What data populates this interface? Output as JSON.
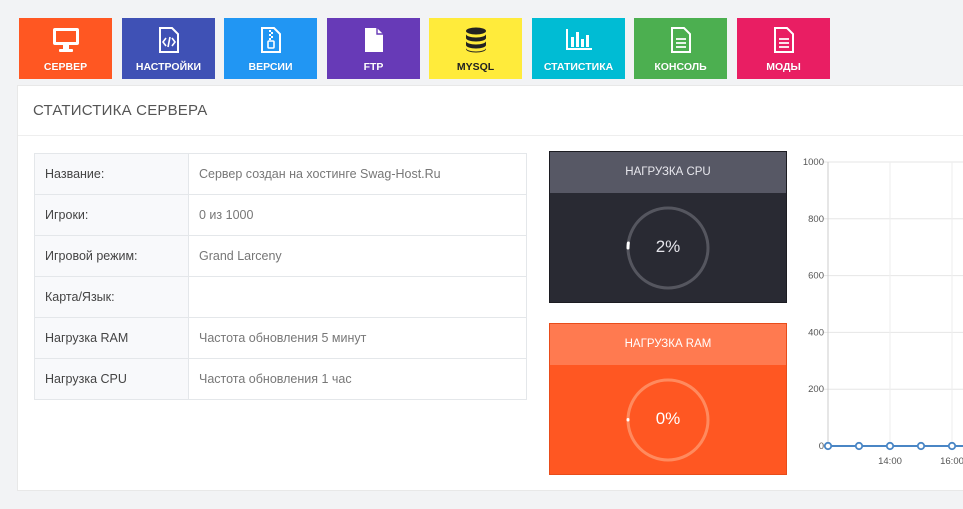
{
  "tabs": [
    {
      "label": "СЕРВЕР",
      "icon": "monitor-icon",
      "color": "#ff5722"
    },
    {
      "label": "НАСТРОЙКИ",
      "icon": "code-file-icon",
      "color": "#3f51b5"
    },
    {
      "label": "ВЕРСИИ",
      "icon": "zip-file-icon",
      "color": "#2196f3"
    },
    {
      "label": "FTP",
      "icon": "file-icon",
      "color": "#673ab7"
    },
    {
      "label": "MYSQL",
      "icon": "database-icon",
      "color": "#ffeb3b"
    },
    {
      "label": "СТАТИСТИКА",
      "icon": "bar-chart-icon",
      "color": "#00bcd4"
    },
    {
      "label": "КОНСОЛЬ",
      "icon": "document-icon",
      "color": "#4caf50"
    },
    {
      "label": "МОДЫ",
      "icon": "document-icon",
      "color": "#e91e63"
    }
  ],
  "panel": {
    "title": "СТАТИСТИКА СЕРВЕРА"
  },
  "info": [
    {
      "key": "Название:",
      "value": "Сервер создан на хостинге Swag-Host.Ru"
    },
    {
      "key": "Игроки:",
      "value": "0 из 1000"
    },
    {
      "key": "Игровой режим:",
      "value": "Grand Larceny"
    },
    {
      "key": "Карта/Язык:",
      "value": ""
    },
    {
      "key": "Нагрузка RAM",
      "value": "Частота обновления 5 минут"
    },
    {
      "key": "Нагрузка CPU",
      "value": "Частота обновления 1 час"
    }
  ],
  "cpu": {
    "title": "НАГРУЗКА CPU",
    "value": "2%",
    "fraction": 0.02
  },
  "ram": {
    "title": "НАГРУЗКА RAM",
    "value": "0%",
    "fraction": 0.0
  },
  "chart_data": {
    "type": "line",
    "yticks": [
      "1000",
      "800",
      "600",
      "400",
      "200",
      "0"
    ],
    "ylim": [
      0,
      1000
    ],
    "xticks": [
      "14:00",
      "16:00"
    ],
    "values": [
      0,
      0,
      0,
      0,
      0,
      0
    ],
    "grid": true,
    "color": "#4a86c5"
  }
}
